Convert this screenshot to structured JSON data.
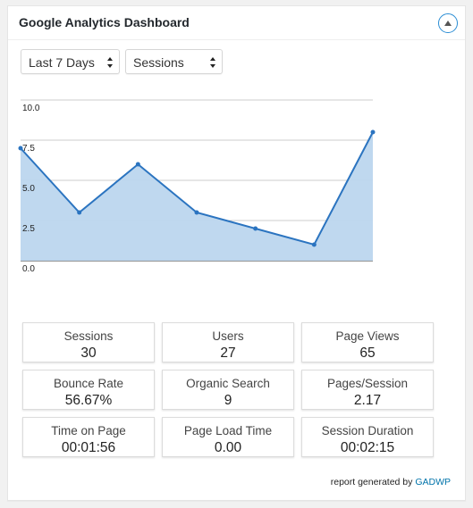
{
  "widget": {
    "title": "Google Analytics Dashboard",
    "toggle_icon": "chevron-up-circle-icon"
  },
  "controls": {
    "period": {
      "selected": "Last 7 Days"
    },
    "metric": {
      "selected": "Sessions"
    }
  },
  "chart_data": {
    "type": "area",
    "x": [
      1,
      2,
      3,
      4,
      5,
      6,
      7
    ],
    "series": [
      {
        "values": [
          7.0,
          3.0,
          6.0,
          3.0,
          2.0,
          1.0,
          8.0
        ]
      }
    ],
    "yticks": [
      "0.0",
      "2.5",
      "5.0",
      "7.5",
      "10.0"
    ],
    "ylim": [
      0,
      10
    ],
    "grid": true,
    "colors": {
      "line": "#2b74c0",
      "fill": "#bcd6ee"
    }
  },
  "stats": [
    {
      "label": "Sessions",
      "value": "30"
    },
    {
      "label": "Users",
      "value": "27"
    },
    {
      "label": "Page Views",
      "value": "65"
    },
    {
      "label": "Bounce Rate",
      "value": "56.67%"
    },
    {
      "label": "Organic Search",
      "value": "9"
    },
    {
      "label": "Pages/Session",
      "value": "2.17"
    },
    {
      "label": "Time on Page",
      "value": "00:01:56"
    },
    {
      "label": "Page Load Time",
      "value": "0.00"
    },
    {
      "label": "Session Duration",
      "value": "00:02:15"
    }
  ],
  "footer": {
    "text": "report generated by",
    "link": "GADWP"
  }
}
